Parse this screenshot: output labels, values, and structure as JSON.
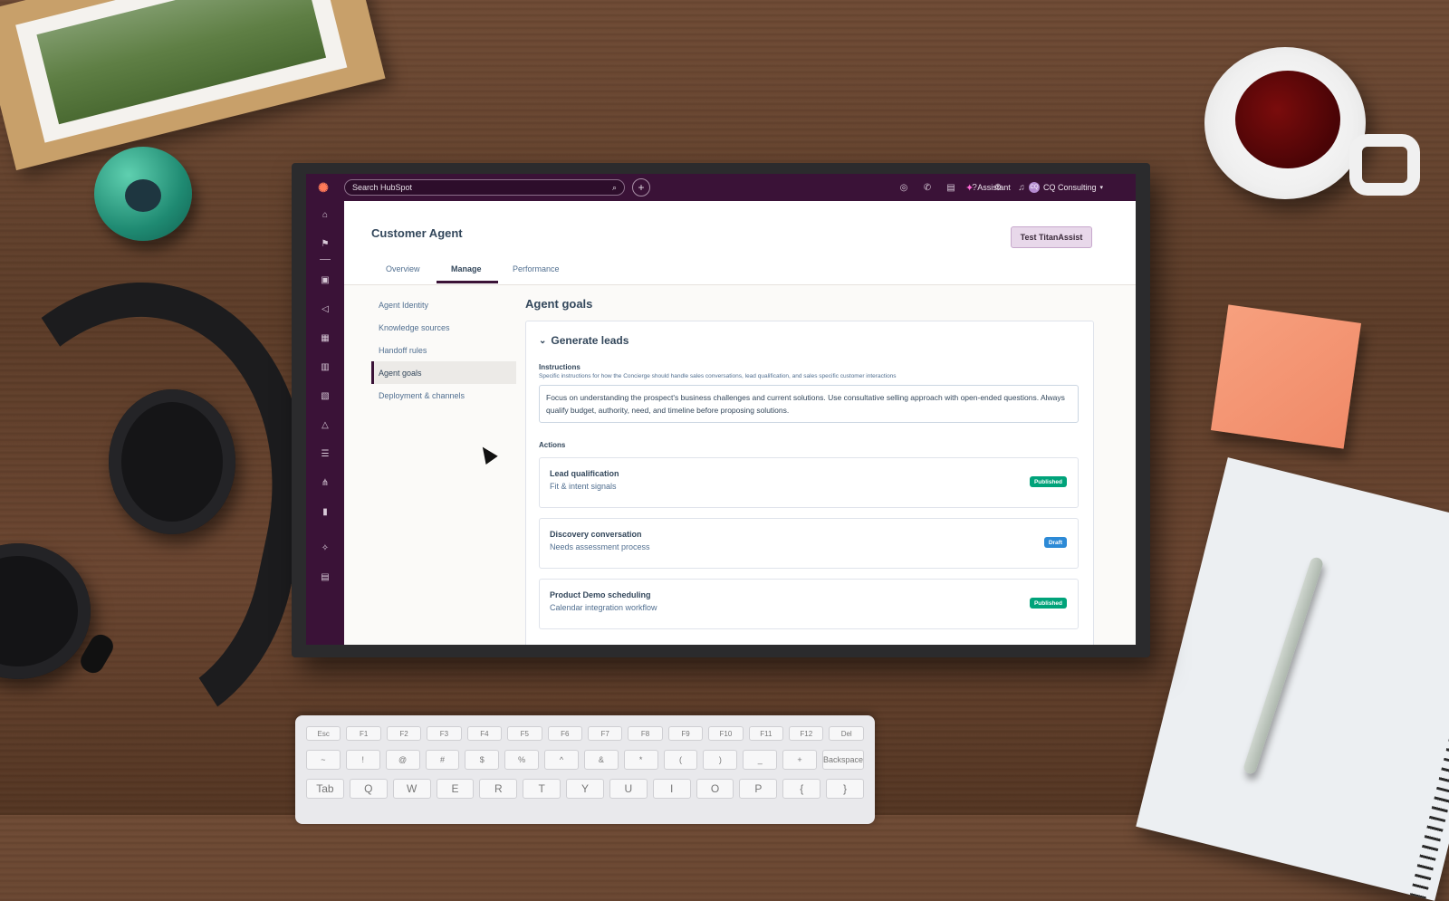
{
  "app": {
    "search_placeholder": "Search HubSpot",
    "assistant_label": "Assistant",
    "account_initials": "CQ",
    "account_name": "CQ Consulting"
  },
  "page": {
    "title": "Customer Agent",
    "test_button": "Test TitanAssist",
    "tabs": [
      {
        "label": "Overview",
        "active": false
      },
      {
        "label": "Manage",
        "active": true
      },
      {
        "label": "Performance",
        "active": false
      }
    ]
  },
  "sidemenu": {
    "items": [
      {
        "label": "Agent Identity",
        "active": false
      },
      {
        "label": "Knowledge sources",
        "active": false
      },
      {
        "label": "Handoff rules",
        "active": false
      },
      {
        "label": "Agent goals",
        "active": true
      },
      {
        "label": "Deployment & channels",
        "active": false
      }
    ]
  },
  "goals": {
    "section_title": "Agent goals",
    "goal_title": "Generate leads",
    "instructions_label": "Instructions",
    "instructions_help": "Specific instructions for how the Concierge should handle sales conversations, lead qualification, and sales specific customer interactions",
    "instructions_text": "Focus on understanding the prospect's business challenges and current solutions. Use consultative selling approach with open-ended questions. Always qualify budget, authority, need, and timeline before proposing solutions.",
    "actions_label": "Actions",
    "actions": [
      {
        "name": "Lead qualification",
        "desc": "Fit & intent signals",
        "status": "Published"
      },
      {
        "name": "Discovery conversation",
        "desc": "Needs assessment process",
        "status": "Draft"
      },
      {
        "name": "Product Demo scheduling",
        "desc": "Calendar integration workflow",
        "status": "Published"
      }
    ]
  },
  "keyboard": {
    "row1": [
      "Esc",
      "F1",
      "F2",
      "F3",
      "F4",
      "F5",
      "F6",
      "F7",
      "F8",
      "F9",
      "F10",
      "F11",
      "F12",
      "Del"
    ],
    "row2": [
      "~",
      "!",
      "@",
      "#",
      "$",
      "%",
      "^",
      "&",
      "*",
      "(",
      ")",
      "_",
      "+",
      "Backspace"
    ],
    "row3": [
      "Tab",
      "Q",
      "W",
      "E",
      "R",
      "T",
      "Y",
      "U",
      "I",
      "O",
      "P",
      "{",
      "}"
    ]
  },
  "colors": {
    "nav_bg": "#3a1237",
    "published": "#00a37a",
    "draft": "#2d8ad6",
    "brand_orange": "#ff7a59"
  }
}
